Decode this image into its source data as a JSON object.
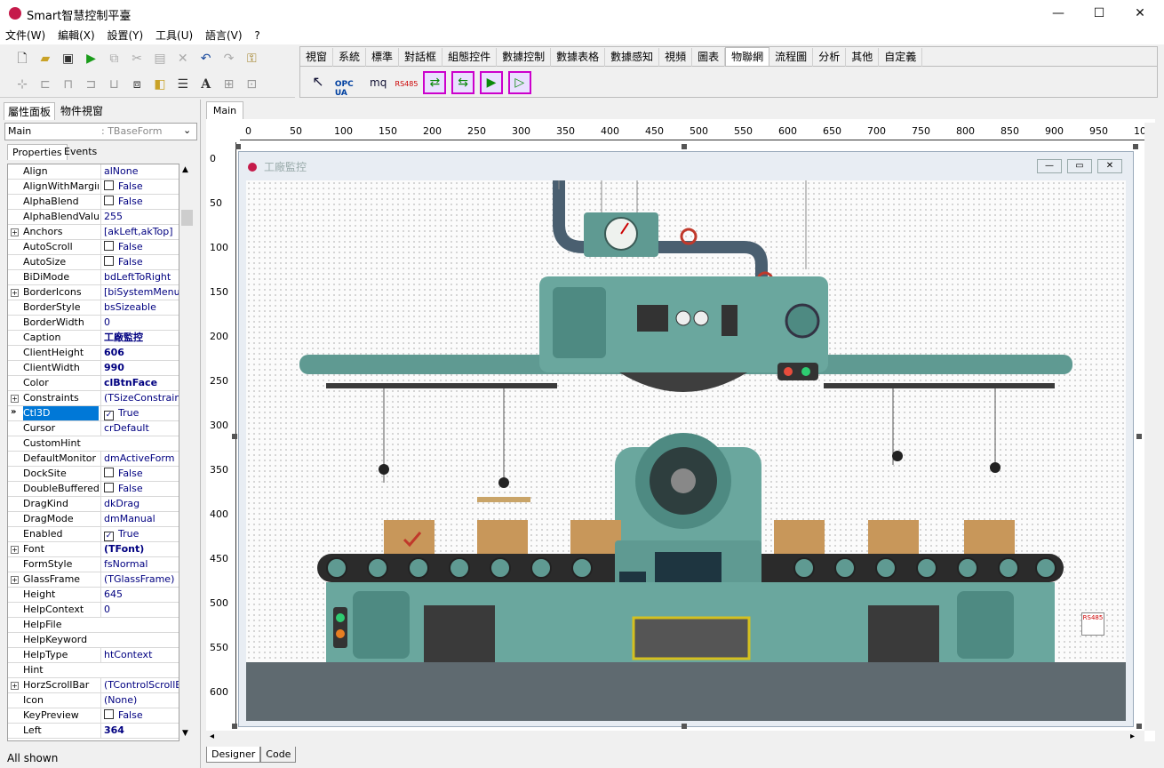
{
  "window": {
    "title": "Smart智慧控制平臺",
    "minimize": "—",
    "maximize": "☐",
    "close": "✕"
  },
  "menu": [
    "文件(W)",
    "編輯(X)",
    "設置(Y)",
    "工具(U)",
    "語言(V)",
    "?"
  ],
  "palette": {
    "tabs": [
      "視窗",
      "系統",
      "標準",
      "對話框",
      "組態控件",
      "數據控制",
      "數據表格",
      "數據感知",
      "視頻",
      "圖表",
      "物聯網",
      "流程圖",
      "分析",
      "其他",
      "自定義"
    ],
    "active_tab": "物聯網",
    "components": [
      "OPC UA",
      "mq",
      "RS485"
    ]
  },
  "left_panel": {
    "tabs": [
      "屬性面板",
      "物件視窗"
    ],
    "selector_name": "Main",
    "selector_type": ": TBaseForm",
    "prop_tabs": [
      "Properties",
      "Events"
    ],
    "status": "All shown"
  },
  "properties": [
    {
      "name": "Align",
      "value": "alNone"
    },
    {
      "name": "AlignWithMargins",
      "value": "False",
      "check": ""
    },
    {
      "name": "AlphaBlend",
      "value": "False",
      "check": ""
    },
    {
      "name": "AlphaBlendValue",
      "value": "255"
    },
    {
      "name": "Anchors",
      "value": "[akLeft,akTop]",
      "exp": "+"
    },
    {
      "name": "AutoScroll",
      "value": "False",
      "check": ""
    },
    {
      "name": "AutoSize",
      "value": "False",
      "check": ""
    },
    {
      "name": "BiDiMode",
      "value": "bdLeftToRight"
    },
    {
      "name": "BorderIcons",
      "value": "[biSystemMenu,biM",
      "exp": "+"
    },
    {
      "name": "BorderStyle",
      "value": "bsSizeable"
    },
    {
      "name": "BorderWidth",
      "value": "0"
    },
    {
      "name": "Caption",
      "value": "工廠監控",
      "bold": true
    },
    {
      "name": "ClientHeight",
      "value": "606",
      "bold": true
    },
    {
      "name": "ClientWidth",
      "value": "990",
      "bold": true
    },
    {
      "name": "Color",
      "value": "clBtnFace",
      "bold": true
    },
    {
      "name": "Constraints",
      "value": "(TSizeConstraints)",
      "exp": "+"
    },
    {
      "name": "Ctl3D",
      "value": "True",
      "check": "✓",
      "selected": true
    },
    {
      "name": "Cursor",
      "value": "crDefault"
    },
    {
      "name": "CustomHint",
      "value": ""
    },
    {
      "name": "DefaultMonitor",
      "value": "dmActiveForm"
    },
    {
      "name": "DockSite",
      "value": "False",
      "check": ""
    },
    {
      "name": "DoubleBuffered",
      "value": "False",
      "check": ""
    },
    {
      "name": "DragKind",
      "value": "dkDrag"
    },
    {
      "name": "DragMode",
      "value": "dmManual"
    },
    {
      "name": "Enabled",
      "value": "True",
      "check": "✓"
    },
    {
      "name": "Font",
      "value": "(TFont)",
      "bold": true,
      "exp": "+"
    },
    {
      "name": "FormStyle",
      "value": "fsNormal"
    },
    {
      "name": "GlassFrame",
      "value": "(TGlassFrame)",
      "exp": "+"
    },
    {
      "name": "Height",
      "value": "645"
    },
    {
      "name": "HelpContext",
      "value": "0"
    },
    {
      "name": "HelpFile",
      "value": ""
    },
    {
      "name": "HelpKeyword",
      "value": ""
    },
    {
      "name": "HelpType",
      "value": "htContext"
    },
    {
      "name": "Hint",
      "value": ""
    },
    {
      "name": "HorzScrollBar",
      "value": "(TControlScrollBar)",
      "exp": "+"
    },
    {
      "name": "Icon",
      "value": "(None)"
    },
    {
      "name": "KeyPreview",
      "value": "False",
      "check": ""
    },
    {
      "name": "Left",
      "value": "364",
      "bold": true
    }
  ],
  "designer": {
    "tab": "Main",
    "form_caption": "工廠監控",
    "hruler": [
      "0",
      "50",
      "100",
      "150",
      "200",
      "250",
      "300",
      "350",
      "400",
      "450",
      "500",
      "550",
      "600",
      "650",
      "700",
      "750",
      "800",
      "850",
      "900",
      "950",
      "10"
    ],
    "vruler": [
      "0",
      "50",
      "100",
      "150",
      "200",
      "250",
      "300",
      "350",
      "400",
      "450",
      "500",
      "550",
      "600"
    ],
    "bottom_tabs": [
      "Designer",
      "Code"
    ],
    "rs485": "RS485"
  }
}
